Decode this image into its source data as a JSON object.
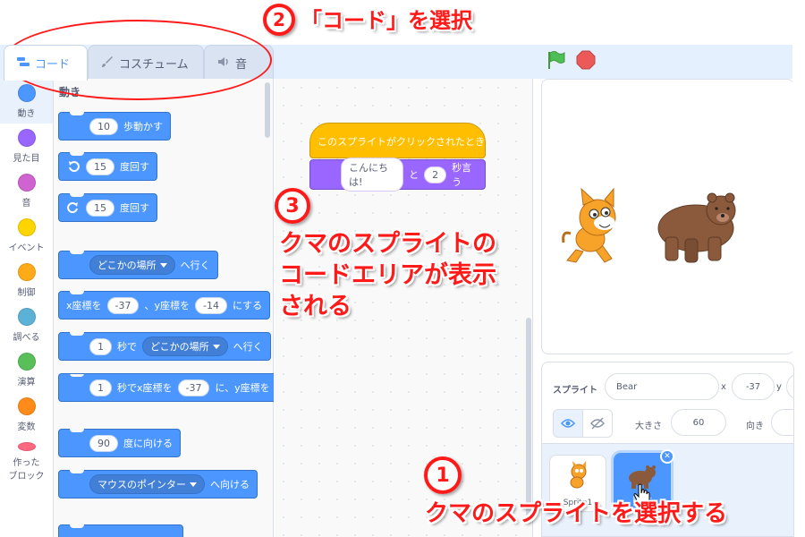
{
  "tabs": {
    "code": "コード",
    "costume": "コスチューム",
    "sound": "音"
  },
  "categories": [
    {
      "label": "動き",
      "color": "#4c97ff"
    },
    {
      "label": "見た目",
      "color": "#9966ff"
    },
    {
      "label": "音",
      "color": "#cf63cf"
    },
    {
      "label": "イベント",
      "color": "#ffd500"
    },
    {
      "label": "制御",
      "color": "#ffab19"
    },
    {
      "label": "調べる",
      "color": "#5cb1d6"
    },
    {
      "label": "演算",
      "color": "#59c059"
    },
    {
      "label": "変数",
      "color": "#ff8c1a"
    },
    {
      "label": "作った",
      "label2": "ブロック",
      "color": "#ff6680"
    }
  ],
  "palette": {
    "heading": "動き",
    "move": {
      "value": "10",
      "text": "歩動かす"
    },
    "turn_right": {
      "value": "15",
      "text": "度回す"
    },
    "turn_left": {
      "value": "15",
      "text": "度回す"
    },
    "goto": {
      "option": "どこかの場所",
      "text": "へ行く"
    },
    "goto_xy": {
      "x_label": "x座標を",
      "x": "-37",
      "sep": "、y座標を",
      "y": "-14",
      "text": "にする"
    },
    "glide": {
      "secs": "1",
      "mid": "秒で",
      "option": "どこかの場所",
      "text": "へ行く"
    },
    "glide_xy": {
      "secs": "1",
      "mid": "秒でx座標を",
      "x": "-37",
      "sep": "に、y座標を"
    },
    "point_dir": {
      "value": "90",
      "text": "度に向ける"
    },
    "point_towards": {
      "option": "マウスのポインター",
      "text": "へ向ける"
    }
  },
  "script": {
    "hat": "このスプライトがクリックされたとき",
    "say_text": "こんにちは!",
    "say_mid": "と",
    "say_secs": "2",
    "say_end": "秒言う"
  },
  "sprite_info": {
    "sprite_label": "スプライト",
    "sprite_name": "Bear",
    "x_label": "x",
    "x_value": "-37",
    "y_label": "y",
    "size_label": "大きさ",
    "size_value": "60",
    "direction_label": "向き"
  },
  "sprites": [
    {
      "name": "Sprite1"
    },
    {
      "name": "Bear"
    }
  ],
  "annotations": {
    "step2_num": "②",
    "step2_text": "「コード」を選択",
    "step3_num": "③",
    "step3_line1": "クマのスプライトの",
    "step3_line2": "コードエリアが表示",
    "step3_line3": "される",
    "step1_num": "①",
    "step1_text": "クマのスプライトを選択する"
  },
  "colors": {
    "motion": "#4c97ff",
    "looks": "#9966ff",
    "events": "#ffbf00",
    "annotation": "#ff1a1a"
  }
}
